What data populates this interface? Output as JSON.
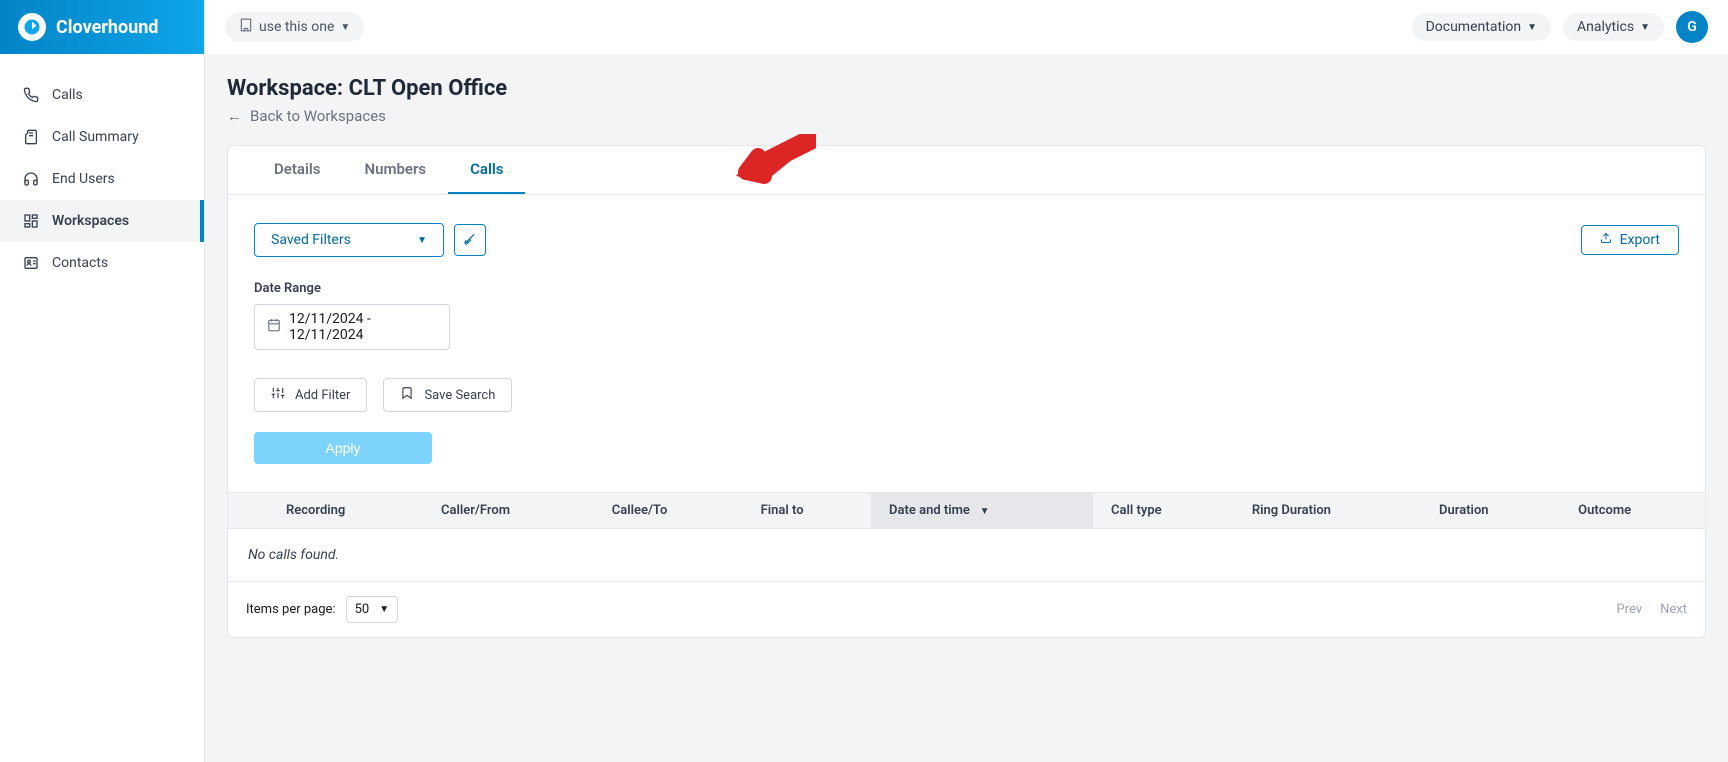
{
  "brand": {
    "name": "Cloverhound"
  },
  "sidebar": {
    "items": [
      {
        "label": "Calls"
      },
      {
        "label": "Call Summary"
      },
      {
        "label": "End Users"
      },
      {
        "label": "Workspaces"
      },
      {
        "label": "Contacts"
      }
    ]
  },
  "topbar": {
    "workspace_label": "use this one",
    "documentation_label": "Documentation",
    "analytics_label": "Analytics",
    "avatar_initial": "G"
  },
  "page": {
    "title": "Workspace: CLT Open Office",
    "back_label": "Back to Workspaces"
  },
  "tabs": [
    {
      "label": "Details",
      "active": false
    },
    {
      "label": "Numbers",
      "active": false
    },
    {
      "label": "Calls",
      "active": true
    }
  ],
  "filters": {
    "saved_filters_label": "Saved Filters",
    "export_label": "Export",
    "date_range_label": "Date Range",
    "date_range_value": "12/11/2024 - 12/11/2024",
    "add_filter_label": "Add Filter",
    "save_search_label": "Save Search",
    "apply_label": "Apply"
  },
  "table": {
    "columns": [
      "Recording",
      "Caller/From",
      "Callee/To",
      "Final to",
      "Date and time",
      "Call type",
      "Ring Duration",
      "Duration",
      "Outcome"
    ],
    "sorted_column": "Date and time",
    "empty_message": "No calls found."
  },
  "pagination": {
    "items_per_page_label": "Items per page:",
    "items_per_page_value": "50",
    "prev_label": "Prev",
    "next_label": "Next"
  }
}
